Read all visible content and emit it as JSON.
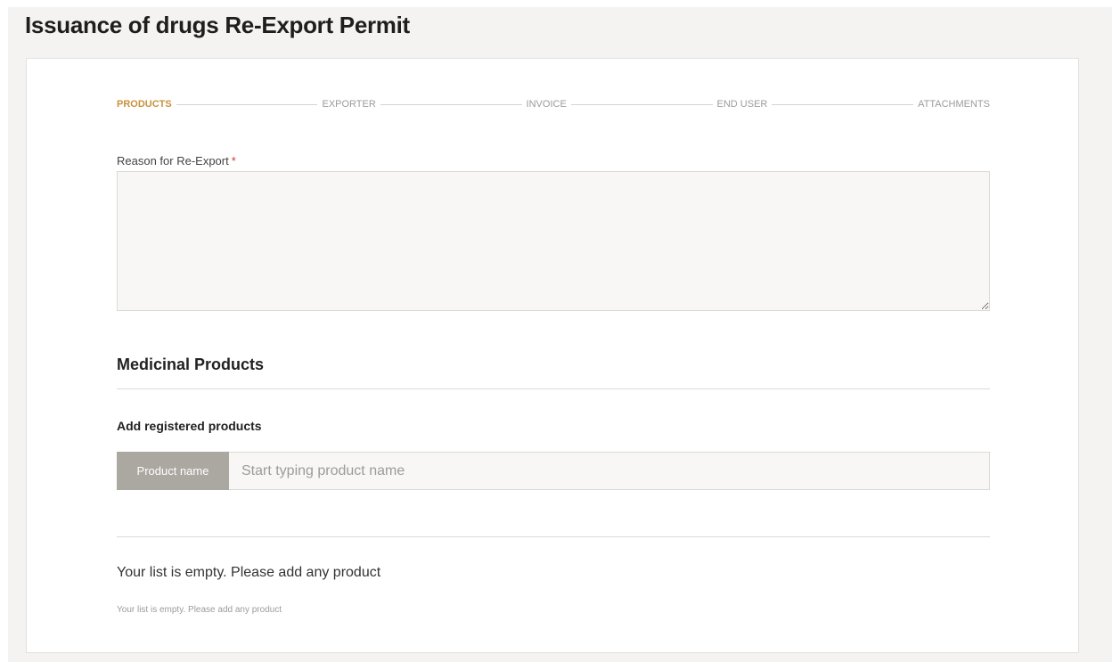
{
  "page": {
    "title": "Issuance of drugs Re-Export Permit"
  },
  "stepper": {
    "steps": [
      {
        "label": "PRODUCTS",
        "active": true
      },
      {
        "label": "EXPORTER",
        "active": false
      },
      {
        "label": "INVOICE",
        "active": false
      },
      {
        "label": "END USER",
        "active": false
      },
      {
        "label": "ATTACHMENTS",
        "active": false
      }
    ]
  },
  "reason": {
    "label": "Reason for Re-Export",
    "required_marker": "*",
    "value": ""
  },
  "medicinal_products": {
    "title": "Medicinal Products",
    "add_registered_title": "Add registered products",
    "product_addon_label": "Product name",
    "product_input_placeholder": "Start typing product name",
    "product_input_value": ""
  },
  "product_list": {
    "empty_message": "Your list is empty. Please add any product",
    "empty_hint": "Your list is empty. Please add any product"
  },
  "colors": {
    "accent": "#c8923c",
    "required": "#d9343a",
    "addon_bg": "#aba7a1",
    "page_bg": "#f4f3f1"
  }
}
